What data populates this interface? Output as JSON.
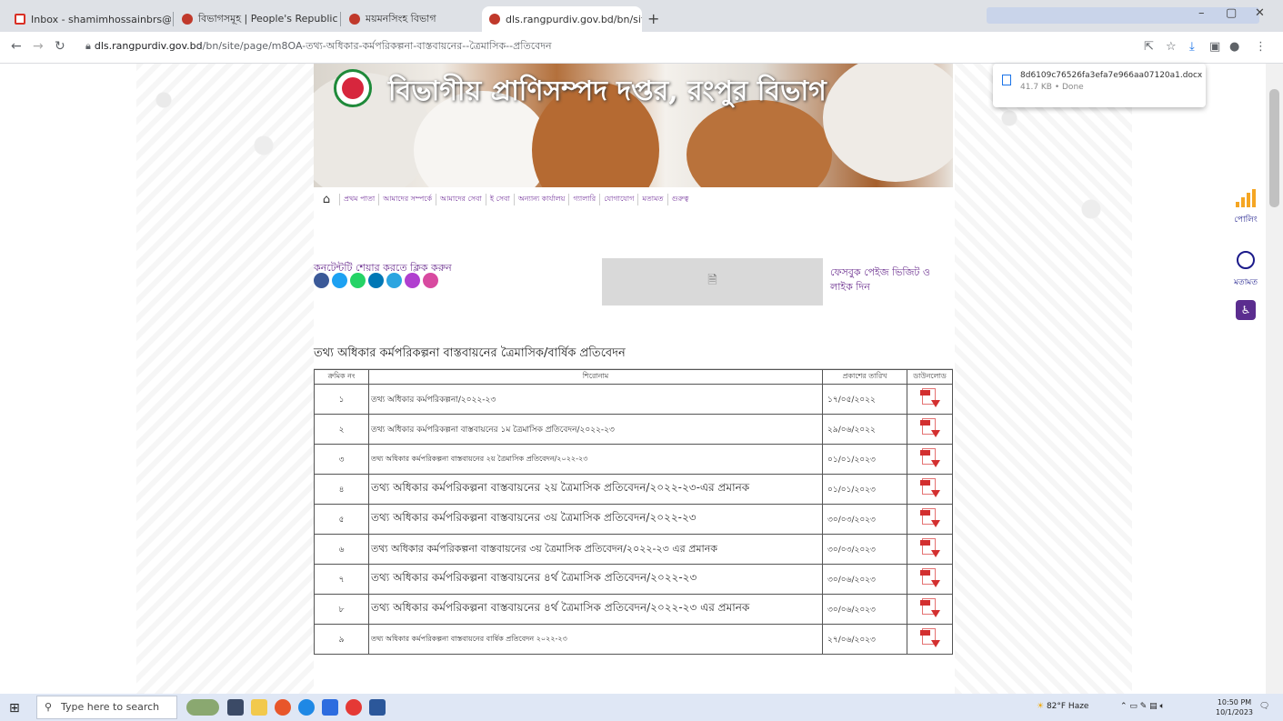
{
  "browser": {
    "tabs": [
      {
        "title": "Inbox - shamimhossainbrs@gm",
        "active": false
      },
      {
        "title": "বিভাগসমূহ | People's Republic o",
        "active": false
      },
      {
        "title": "ময়মনসিংহ বিভাগ",
        "active": false
      },
      {
        "title": "dls.rangpurdiv.gov.bd/bn/site/p",
        "active": true
      }
    ],
    "url_host": "dls.rangpurdiv.gov.bd",
    "url_path": "/bn/site/page/m8OA-তথ্য-অধিকার-কর্মপরিকল্পনা-বাস্তবায়নের--ত্রৈমাসিক--প্রতিবেদন",
    "download": {
      "filename": "8d6109c76526fa3efa7e966aa07120a1.docx",
      "meta": "41.7 KB • Done"
    }
  },
  "site": {
    "title": "বিভাগীয় প্রাণিসম্পদ দপ্তর, রংপুর বিভাগ",
    "nav": [
      "প্রথম পাতা",
      "আমাদের সম্পর্কে",
      "আমাদের সেবা",
      "ই সেবা",
      "অন্যান্য কার্যালয়",
      "গ্যালারি",
      "যোগাযোগ",
      "মতামত",
      "গুরুত্ব"
    ],
    "share_label": "কনটেন্টটি শেয়ার করতে ক্লিক করুন",
    "social_icons": [
      {
        "name": "facebook-icon",
        "color": "#3b5998"
      },
      {
        "name": "twitter-icon",
        "color": "#1da1f2"
      },
      {
        "name": "whatsapp-icon",
        "color": "#25d366"
      },
      {
        "name": "linkedin-icon",
        "color": "#0077b5"
      },
      {
        "name": "telegram-icon",
        "color": "#2ca5e0"
      },
      {
        "name": "messenger-icon",
        "color": "#b03fcf"
      },
      {
        "name": "email-icon",
        "color": "#d84aa0"
      }
    ],
    "fb_visit_text": "ফেসবুক পেইজ ভিজিট ও লাইক দিন",
    "section_title": "তথ্য অধিকার কর্মপরিকল্পনা বাস্তবায়নের ত্রৈমাসিক/বার্ষিক প্রতিবেদন",
    "table": {
      "headers": [
        "ক্রমিক নং",
        "শিরোনাম",
        "প্রকাশের তারিখ",
        "ডাউনলোড"
      ],
      "rows": [
        {
          "sl": "১",
          "title": "তথ্য অধিকার কর্মপরিকল্পনা/২০২২-২৩",
          "date": "১৭/০৫/২০২২",
          "size": 9
        },
        {
          "sl": "২",
          "title": "তথ্য অধিকার কর্মপরিকল্পনা বাস্তবায়নের ১ম ত্রৈমাসিক   প্রতিবেদন/২০২২-২৩",
          "date": "২৯/০৬/২০২২",
          "size": 9
        },
        {
          "sl": "৩",
          "title": "তথ্য অধিকার কর্মপরিকল্পনা বাস্তবায়নের ২য় ত্রৈমাসিক  প্রতিবেদন/২০২২-২৩",
          "date": "০১/০১/২০২৩",
          "size": 8
        },
        {
          "sl": "৪",
          "title": "তথ্য অধিকার কর্মপরিকল্পনা বাস্তবায়নের ২য় ত্রৈমাসিক  প্রতিবেদন/২০২২-২৩-এর প্রমানক",
          "date": "০১/০১/২০২৩",
          "size": 12
        },
        {
          "sl": "৫",
          "title": "তথ্য অধিকার কর্মপরিকল্পনা বাস্তবায়নের ৩য় ত্রৈমাসিক  প্রতিবেদন/২০২২-২৩",
          "date": "৩০/০৩/২০২৩",
          "size": 12
        },
        {
          "sl": "৬",
          "title": "তথ্য অধিকার কর্মপরিকল্পনা বাস্তবায়নের ৩য় ত্রৈমাসিক  প্রতিবেদন/২০২২-২৩ এর প্রমানক",
          "date": "৩০/০৩/২০২৩",
          "size": 11
        },
        {
          "sl": "৭",
          "title": "তথ্য অধিকার কর্মপরিকল্পনা বাস্তবায়নের ৪র্থ ত্রৈমাসিক  প্রতিবেদন/২০২২-২৩",
          "date": "৩০/০৬/২০২৩",
          "size": 12
        },
        {
          "sl": "৮",
          "title": "তথ্য অধিকার কর্মপরিকল্পনা বাস্তবায়নের ৪র্থ ত্রৈমাসিক  প্রতিবেদন/২০২২-২৩ এর প্রমানক",
          "date": "৩০/০৬/২০২৩",
          "size": 12
        },
        {
          "sl": "৯",
          "title": "তথ্য অধিকার কর্মপরিকল্পনা বাস্তবায়নের  বার্ষিক প্রতিবেদন ২০২২-২৩",
          "date": "২৭/০৬/২০২৩",
          "size": 8
        }
      ]
    }
  },
  "side": {
    "poll_label": "পোলিং",
    "feedback_label": "মতামত"
  },
  "taskbar": {
    "search_placeholder": "Type here to search",
    "weather": "82°F  Haze",
    "time": "10:50 PM",
    "date": "10/1/2023"
  }
}
